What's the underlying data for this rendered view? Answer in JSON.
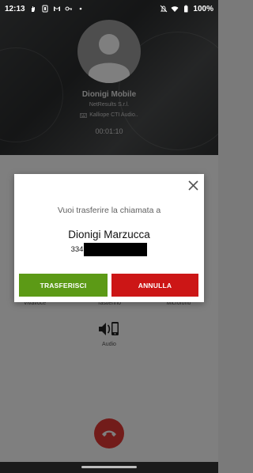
{
  "status_bar": {
    "time": "12:13",
    "battery": "100%",
    "icons_left": [
      "hand-icon",
      "nfc-icon",
      "gmail-icon",
      "key-icon",
      "dot-icon"
    ],
    "icons_right": [
      "mute-bell-icon",
      "wifi-icon",
      "battery-icon"
    ]
  },
  "call": {
    "caller_name": "Dionigi Mobile",
    "company": "NetResults S.r.l.",
    "app_name": "Kalliope CTI Audio..",
    "timer": "00:01:10"
  },
  "controls": {
    "labels": [
      "Vivavoce",
      "Tastierino",
      "Microfono",
      "Audio"
    ]
  },
  "dialog": {
    "question": "Vuoi trasferire la chiamata a",
    "target_name": "Dionigi Marzucca",
    "target_number_visible": "334",
    "transfer_label": "TRASFERISCI",
    "cancel_label": "ANNULLA"
  },
  "colors": {
    "transfer_button": "#5c9a16",
    "cancel_button": "#cc1616",
    "hangup_button": "#e53935"
  }
}
